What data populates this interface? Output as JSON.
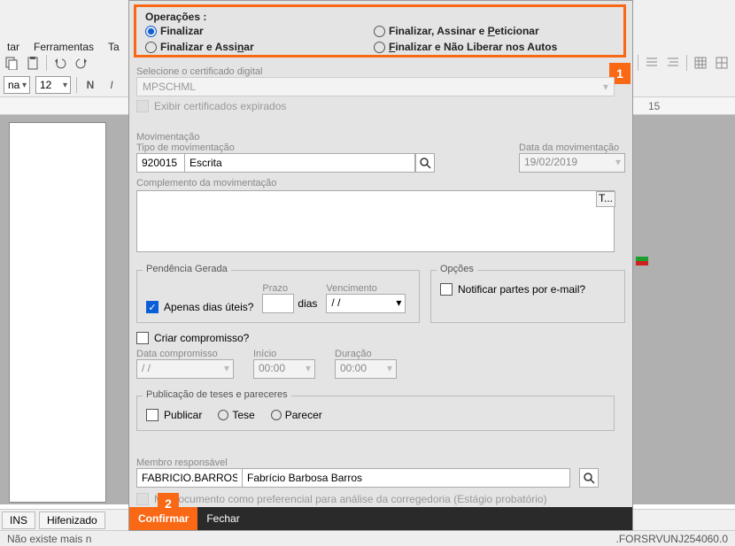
{
  "menu": {
    "tar": "tar",
    "ferramentas": "Ferramentas",
    "ta": "Ta"
  },
  "toolbar": {
    "font_name": "na",
    "font_size": "12",
    "bold": "N",
    "italic": "I"
  },
  "ruler": {
    "mark15": "15"
  },
  "status": {
    "ins": "INS",
    "hifen": "Hifenizado",
    "noexist": "Não existe mais n",
    "srv": ".FORSRVUNJ254060.0"
  },
  "dialog": {
    "operacoes": {
      "title": "Operações :",
      "finalizar": "Finalizar",
      "finalizar_assinar": "Finalizar e Assinar",
      "finalizar_assinar_pet": "Finalizar, Assinar e Peticionar",
      "finalizar_nao_liberar": "Finalizar e Não Liberar nos Autos",
      "accel_a": "A",
      "accel_n": "n",
      "accel_p": "P",
      "accel_f": "F"
    },
    "cert": {
      "label": "Selecione o certificado digital",
      "value": "MPSCHML",
      "exp": "Exibir certificados expirados"
    },
    "mov": {
      "title": "Movimentação",
      "tipo_lbl": "Tipo de movimentação",
      "tipo_code": "920015",
      "tipo_desc": "Escrita",
      "data_lbl": "Data da movimentação",
      "data_val": "19/02/2019",
      "compl_lbl": "Complemento da movimentação",
      "t_btn": "T..."
    },
    "pend": {
      "title": "Pendência Gerada",
      "apenas": "Apenas dias úteis?",
      "prazo": "Prazo",
      "dias": "dias",
      "venc": "Vencimento",
      "venc_val": "/  /"
    },
    "opcoes": {
      "title": "Opções",
      "notif": "Notificar partes por e-mail?"
    },
    "comp": {
      "criar": "Criar compromisso?",
      "data_lbl": "Data compromisso",
      "data_val": "/  /",
      "inicio_lbl": "Início",
      "inicio_val": "00:00",
      "dur_lbl": "Duração",
      "dur_val": "00:00"
    },
    "pub": {
      "title": "Publicação de teses e pareceres",
      "publicar": "Publicar",
      "tese": "Tese",
      "parecer": "Parecer"
    },
    "membro": {
      "lbl": "Membro responsável",
      "login": "FABRICIO.BARROS",
      "nome": "Fabrício Barbosa Barros",
      "pref_doc_a": "M",
      "pref_doc_b": "r documento como preferencial para análise da corregedoria (Estágio probatório)"
    },
    "buttons": {
      "confirmar": "Confirmar",
      "fechar": "Fechar"
    },
    "badges": {
      "b1": "1",
      "b2": "2"
    }
  }
}
